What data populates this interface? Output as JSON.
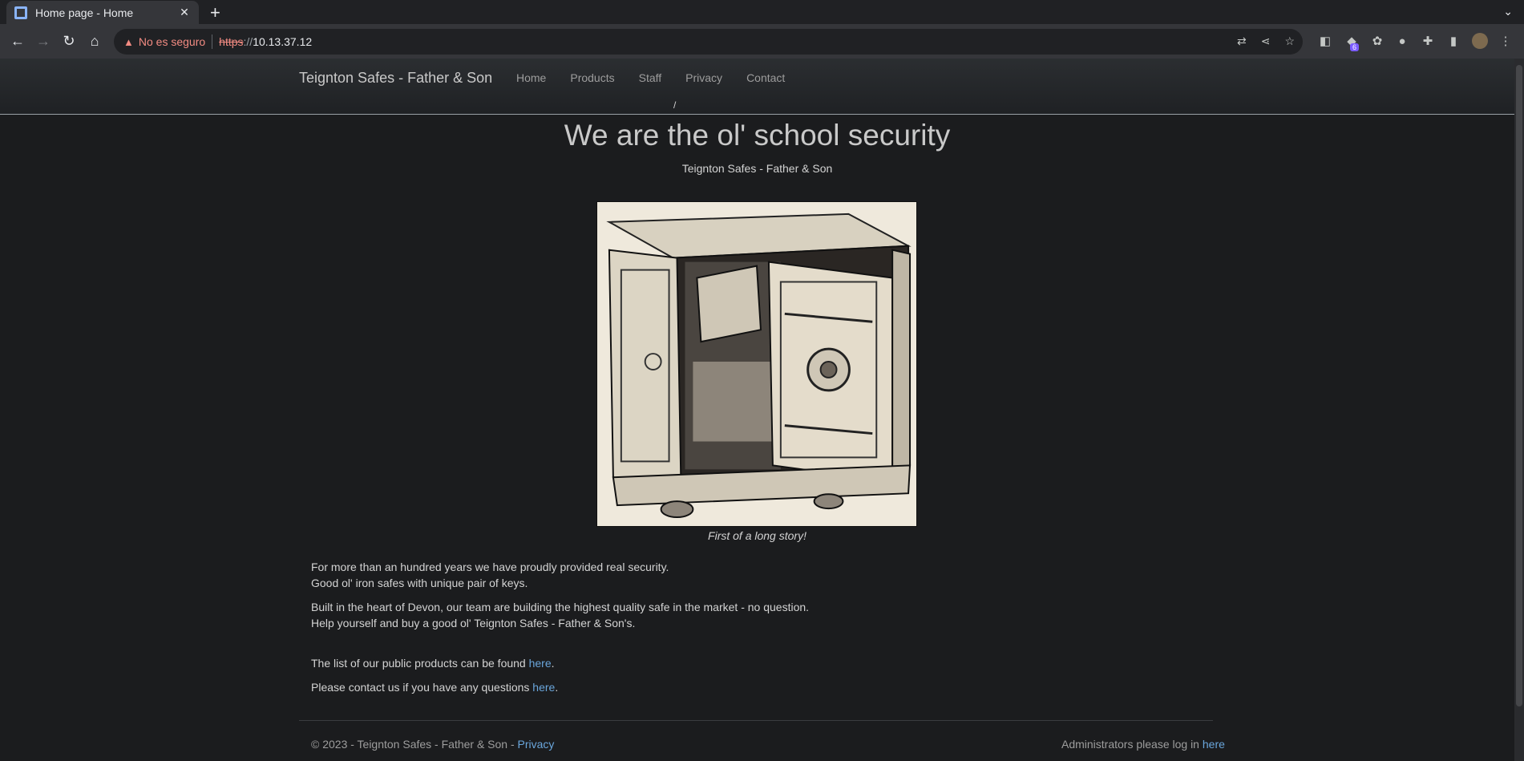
{
  "browser": {
    "tab_title": "Home page - Home",
    "security_label": "No es seguro",
    "url_scheme": "https",
    "url_scheme_rest": "://",
    "url_host": "10.13.37.12",
    "extension_badge": "6"
  },
  "site": {
    "brand": "Teignton Safes - Father & Son",
    "nav": [
      "Home",
      "Products",
      "Staff",
      "Privacy",
      "Contact"
    ],
    "breadcrumb": "/"
  },
  "hero": {
    "title": "We are the ol' school security",
    "subtitle": "Teignton Safes - Father & Son",
    "image_caption": "First of a long story!"
  },
  "content": {
    "p1_line1": "For more than an hundred years we have proudly provided real security.",
    "p1_line2": "Good ol' iron safes with unique pair of keys.",
    "p2_line1": "Built in the heart of Devon, our team are building the highest quality safe in the market - no question.",
    "p2_line2": "Help yourself and buy a good ol' Teignton Safes - Father & Son's.",
    "products_text": "The list of our public products can be found ",
    "products_link": "here",
    "contact_text": "Please contact us if you have any questions ",
    "contact_link": "here",
    "period": "."
  },
  "footer": {
    "copyright": "© 2023 - Teignton Safes - Father & Son - ",
    "privacy_link": "Privacy",
    "admin_text": "Administrators please log in ",
    "admin_link": "here"
  },
  "colors": {
    "page_bg": "#1b1c1e",
    "link": "#6aa6dc",
    "insecure": "#f28b82"
  }
}
